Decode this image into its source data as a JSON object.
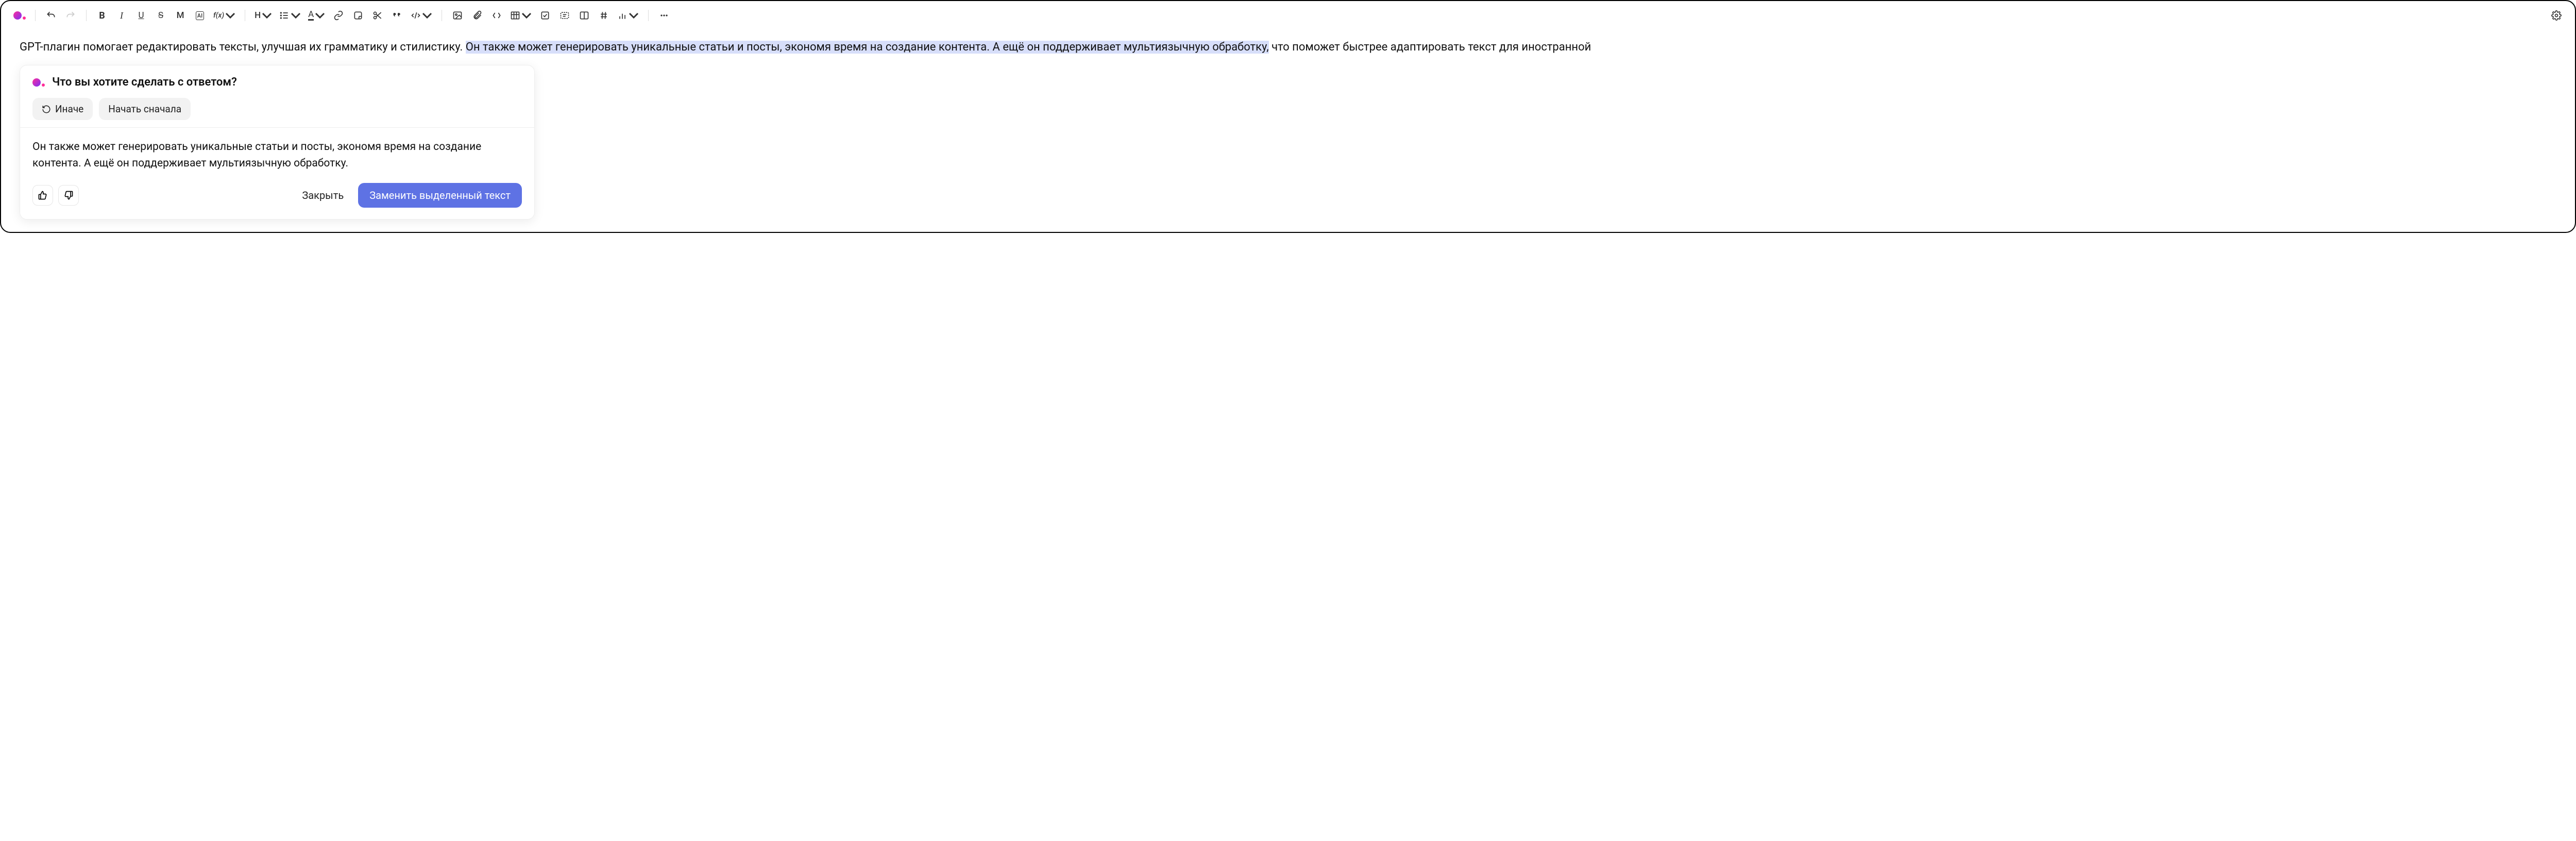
{
  "content": {
    "before": "GPT-плагин помогает редактировать тексты, улучшая их грамматику и стилистику. ",
    "highlighted": "Он также может генерировать уникальные статьи и посты, экономя время на создание контента. А ещё он поддерживает мультиязычную обработку,",
    "after": " что поможет быстрее адаптировать текст для иностранной"
  },
  "ai": {
    "title": "Что вы хотите сделать с ответом?",
    "retry": "Иначе",
    "restart": "Начать сначала",
    "body": "Он также может генерировать уникальные статьи и посты, экономя время на создание контента. А ещё он поддерживает мультиязычную обработку.",
    "close": "Закрыть",
    "replace": "Заменить выделенный текст"
  },
  "toolbar": {
    "heading_label": "H",
    "color_label": "A",
    "fx_label": "f(x)",
    "ai_label": "AI",
    "m_label": "M"
  }
}
